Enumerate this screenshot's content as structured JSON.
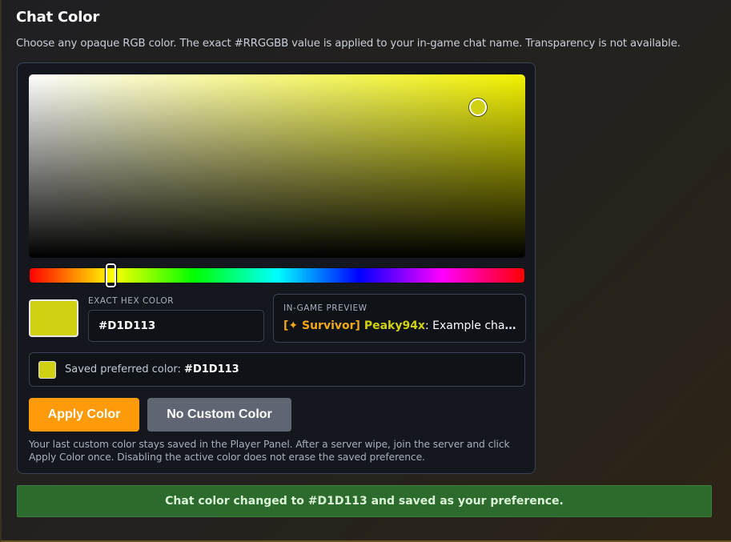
{
  "header": {
    "title": "Chat Color",
    "description": "Choose any opaque RGB color. The exact #RRGGBB value is applied to your in-game chat name. Transparency is not available."
  },
  "picker": {
    "current_color": "#D1D113",
    "hue_color": "#F2F200"
  },
  "hex": {
    "label": "EXACT HEX COLOR",
    "value": "#D1D113"
  },
  "preview": {
    "label": "IN-GAME PREVIEW",
    "tag": "[✦ Survivor]",
    "name": "Peaky94x",
    "message": ": Example chat message"
  },
  "saved": {
    "label": "Saved preferred color:",
    "value": "#D1D113"
  },
  "buttons": {
    "apply": "Apply Color",
    "none": "No Custom Color"
  },
  "note": "Your last custom color stays saved in the Player Panel. After a server wipe, join the server and click Apply Color once. Disabling the active color does not erase the saved preference.",
  "toast": "Chat color changed to #D1D113 and saved as your preference."
}
